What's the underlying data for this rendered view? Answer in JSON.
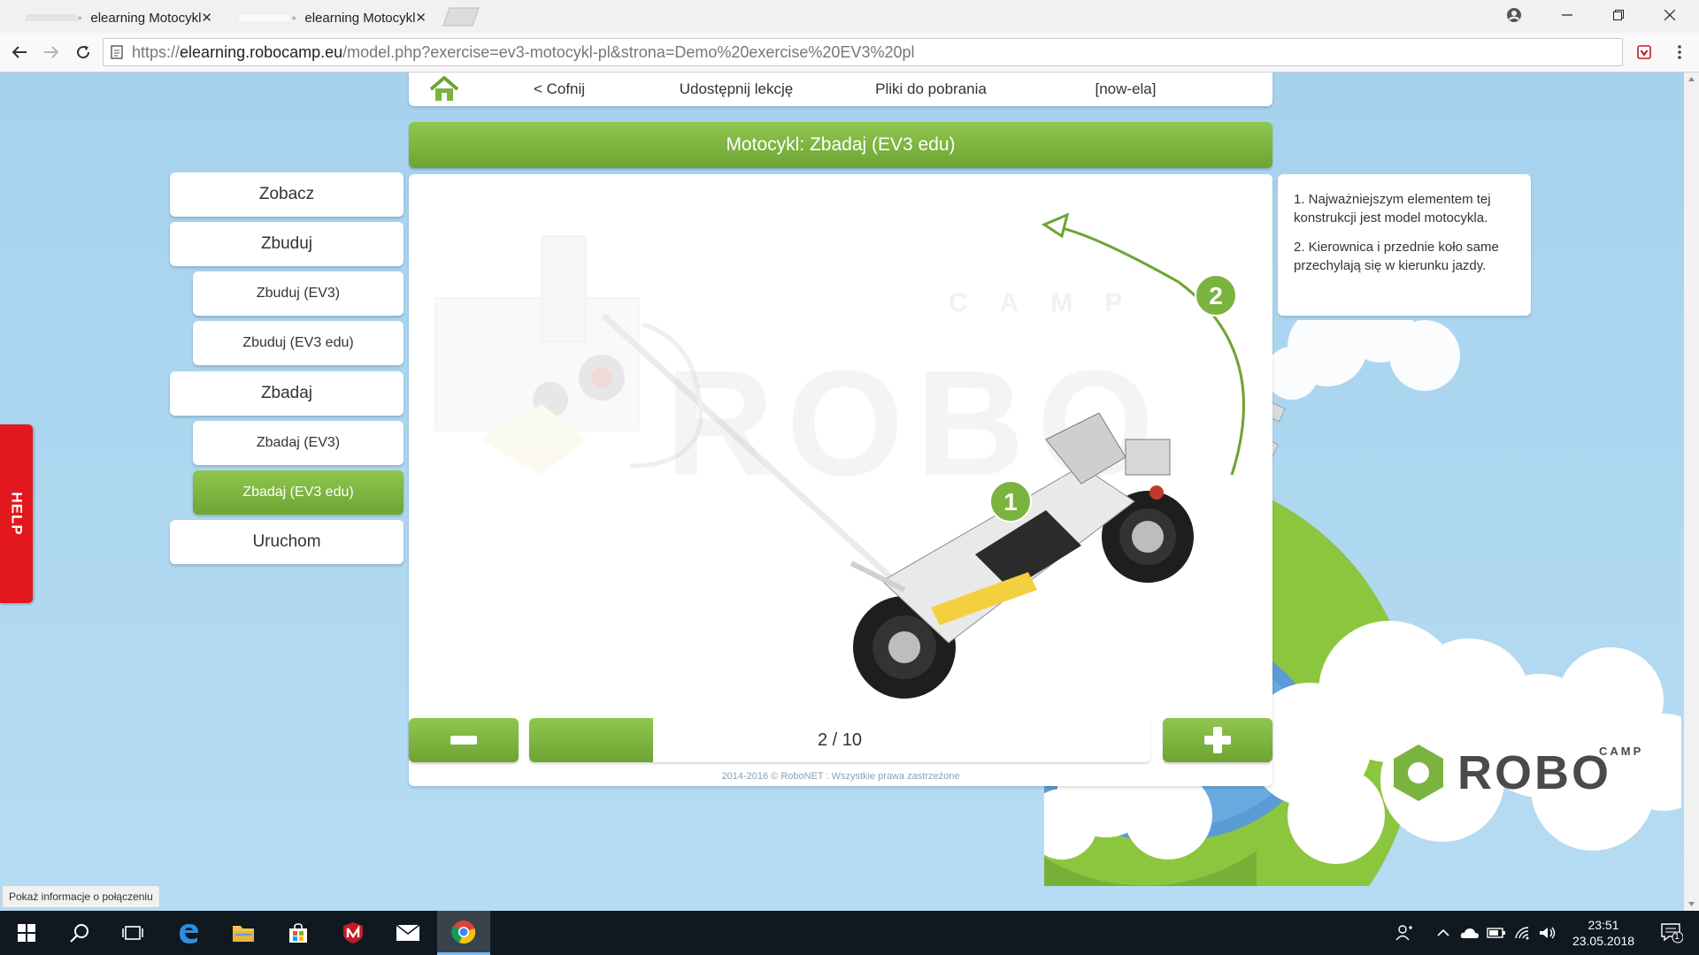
{
  "browser": {
    "tabs": [
      {
        "title": "elearning Motocykl",
        "active": false
      },
      {
        "title": "elearning Motocykl",
        "active": true
      }
    ],
    "url": {
      "scheme": "https://",
      "host": "elearning.robocamp.eu",
      "rest": "/model.php?exercise=ev3-motocykl-pl&strona=Demo%20exercise%20EV3%20pl"
    }
  },
  "nav": {
    "back": "< Cofnij",
    "share": "Udostępnij lekcję",
    "files": "Pliki do pobrania",
    "user": "[now-ela]"
  },
  "lesson_title": "Motocykl: Zbadaj (EV3 edu)",
  "menu": [
    {
      "label": "Zobacz",
      "level": "main",
      "active": false
    },
    {
      "label": "Zbuduj",
      "level": "main",
      "active": false
    },
    {
      "label": "Zbuduj (EV3)",
      "level": "sub",
      "active": false
    },
    {
      "label": "Zbuduj (EV3 edu)",
      "level": "sub",
      "active": false
    },
    {
      "label": "Zbadaj",
      "level": "main",
      "active": false
    },
    {
      "label": "Zbadaj (EV3)",
      "level": "sub",
      "active": false
    },
    {
      "label": "Zbadaj (EV3 edu)",
      "level": "sub",
      "active": true
    },
    {
      "label": "Uruchom",
      "level": "main",
      "active": false
    }
  ],
  "content": {
    "watermark_small": "CAMP",
    "watermark_big": "ROBO",
    "markers": [
      "1",
      "2"
    ]
  },
  "info": {
    "p1": "1. Najważniejszym elementem tej konstrukcji jest model motocykla.",
    "p2": "2. Kierownica i przednie koło same przechylają się w kierunku jazdy."
  },
  "pager": {
    "current": 2,
    "total": 10,
    "label": "2 / 10"
  },
  "footer": "2014-2016 © RoboNET : Wszystkie prawa zastrzeżone",
  "logo": {
    "small": "CAMP",
    "big": "ROBO"
  },
  "help_label": "HELP",
  "status_tip": "Pokaż informacje o połączeniu",
  "clock": {
    "time": "23:51",
    "date": "23.05.2018"
  },
  "notification_count": "1",
  "colors": {
    "accent_green": "#7ab33e",
    "help_red": "#e3171e",
    "sky": "#a9d4ef"
  }
}
